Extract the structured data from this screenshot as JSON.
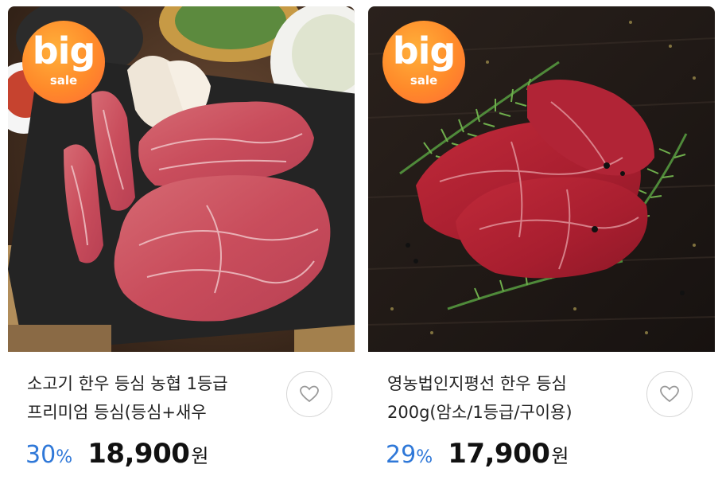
{
  "colors": {
    "discount": "#2f78d8",
    "badge": "#ff8a2a",
    "price": "#111111"
  },
  "products": [
    {
      "badge": {
        "big": "big",
        "sale": "sale"
      },
      "title_line1": "소고기 한우 등심 농협 1등급",
      "title_line2": "프리미엄 등심(등심+새우",
      "discount_value": "30",
      "discount_unit": "%",
      "price": "18,900",
      "currency": "원",
      "wishlist_icon": "heart-outline-icon"
    },
    {
      "badge": {
        "big": "big",
        "sale": "sale"
      },
      "title_line1": "영농법인지평선 한우 등심",
      "title_line2": "200g(암소/1등급/구이용)",
      "discount_value": "29",
      "discount_unit": "%",
      "price": "17,900",
      "currency": "원",
      "wishlist_icon": "heart-outline-icon"
    }
  ]
}
